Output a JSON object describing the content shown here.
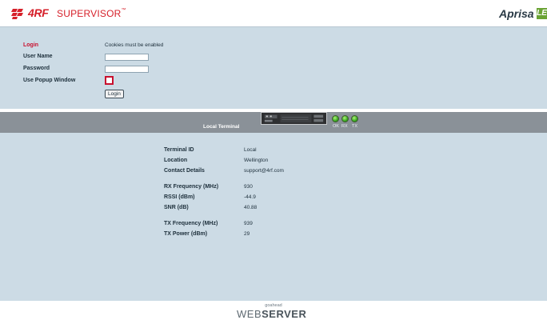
{
  "header": {
    "brand": "4RF",
    "product": "SUPERVISOR",
    "trademark": "™",
    "right_logo": "Aprisa",
    "right_logo_badge": "LE",
    "brand_color": "#d6202a",
    "badge_color": "#6aa334"
  },
  "login": {
    "title": "Login",
    "cookie_note": "Cookies must be enabled",
    "username_label": "User Name",
    "username_value": "",
    "password_label": "Password",
    "password_value": "",
    "popup_label": "Use Popup Window",
    "popup_checked": false,
    "login_button": "Login"
  },
  "terminal_bar": {
    "label": "Local Terminal",
    "leds": [
      {
        "label": "OK",
        "color": "#39a821"
      },
      {
        "label": "RX",
        "color": "#39a821"
      },
      {
        "label": "TX",
        "color": "#39a821"
      }
    ]
  },
  "info": {
    "group1": [
      {
        "key": "Terminal ID",
        "value": "Local"
      },
      {
        "key": "Location",
        "value": "Wellington"
      },
      {
        "key": "Contact Details",
        "value": "support@4rf.com"
      }
    ],
    "group2": [
      {
        "key": "RX Frequency (MHz)",
        "value": "930"
      },
      {
        "key": "RSSI (dBm)",
        "value": "-44.9"
      },
      {
        "key": "SNR (dB)",
        "value": "40.88"
      }
    ],
    "group3": [
      {
        "key": "TX Frequency (MHz)",
        "value": "939"
      },
      {
        "key": "TX Power (dBm)",
        "value": "29"
      }
    ]
  },
  "footer": {
    "top": "goahead",
    "main_light": "WEB",
    "main_bold": "SERVER"
  }
}
